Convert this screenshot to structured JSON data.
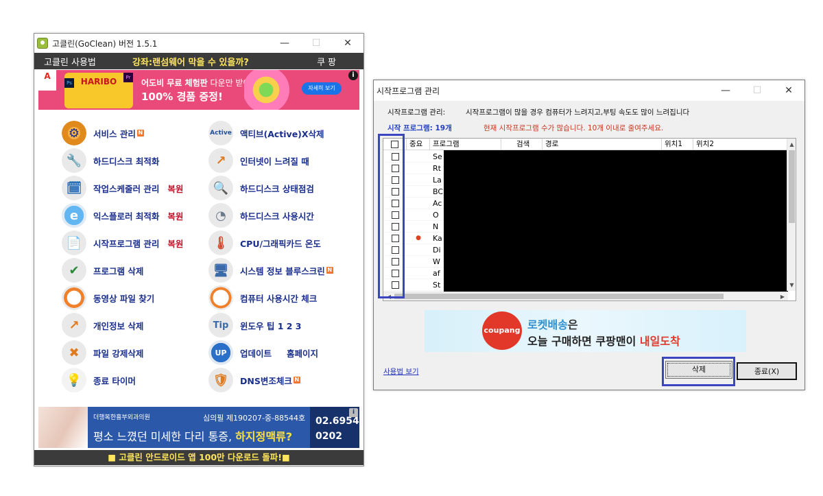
{
  "main_window": {
    "title": "고클린(GoClean) 버전 1.5.1",
    "menu": {
      "left": "고클린 사용법",
      "center": "강좌:랜섬웨어 막을 수 있을까?",
      "right": "쿠팡"
    },
    "top_ad": {
      "adobe_logo": "A",
      "candy_label": "HARIBO",
      "line1_bold": "어도비 무료 체험판",
      "line1_rest": " 다운만 받아도",
      "line2": "100% 경품 증정!",
      "button": "자세히 보기",
      "info": "i"
    },
    "left_items": [
      {
        "label": "서비스 관리",
        "badge": "N",
        "restore": "",
        "icon": "gear-icon"
      },
      {
        "label": "하드디스크 최적화",
        "badge": "",
        "restore": "",
        "icon": "wrench-icon"
      },
      {
        "label": "작업스케줄러 관리",
        "badge": "",
        "restore": "복원",
        "icon": "scheduler-icon"
      },
      {
        "label": "익스플로러 최적화",
        "badge": "",
        "restore": "복원",
        "icon": "ie-icon"
      },
      {
        "label": "시작프로그램 관리",
        "badge": "",
        "restore": "복원",
        "icon": "startup-icon"
      },
      {
        "label": "프로그램 삭제",
        "badge": "",
        "restore": "",
        "icon": "uninstall-icon"
      },
      {
        "label": "동영상 파일 찾기",
        "badge": "",
        "restore": "",
        "icon": "video-search-icon"
      },
      {
        "label": "개인정보 삭제",
        "badge": "",
        "restore": "",
        "icon": "privacy-icon"
      },
      {
        "label": "파일 강제삭제",
        "badge": "",
        "restore": "",
        "icon": "force-delete-icon"
      },
      {
        "label": "종료 타이머",
        "badge": "",
        "restore": "",
        "icon": "timer-icon"
      }
    ],
    "right_items": [
      {
        "label": "액티브(Active)X삭제",
        "badge": "",
        "extra": "",
        "icon": "activex-icon"
      },
      {
        "label": "인터넷이 느려질 때",
        "badge": "",
        "extra": "",
        "icon": "internet-icon"
      },
      {
        "label": "하드디스크 상태점검",
        "badge": "",
        "extra": "",
        "icon": "disk-check-icon"
      },
      {
        "label": "하드디스크 사용시간",
        "badge": "",
        "extra": "",
        "icon": "disk-time-icon"
      },
      {
        "label": "CPU/그래픽카드 온도",
        "badge": "",
        "extra": "",
        "icon": "temperature-icon"
      },
      {
        "label": "시스템 정보  블루스크린",
        "badge": "N",
        "extra": "",
        "icon": "system-info-icon"
      },
      {
        "label": "컴퓨터 사용시간 체크",
        "badge": "",
        "extra": "",
        "icon": "clock-icon"
      },
      {
        "label": "윈도우 팁 1   2   3",
        "badge": "",
        "extra": "",
        "icon": "tip-icon"
      },
      {
        "label": "업데이트",
        "badge": "",
        "extra": "홈페이지",
        "icon": "update-icon"
      },
      {
        "label": "DNS변조체크",
        "badge": "N",
        "extra": "",
        "icon": "shield-icon"
      }
    ],
    "bottom_ad": {
      "clinic": "더행복한흉부외과의원",
      "registration": "심의필 제190207-중-88544호",
      "headline_plain": "평소 느꼈던 미세한 다리 통증, ",
      "headline_bold": "하지정맥류?",
      "phone_line1": "02.6954.",
      "phone_line2": "0202",
      "info": "i"
    },
    "footer": "■ 고클린 안드로이드 앱 100만 다운로드 돌파!■"
  },
  "startup_window": {
    "title": "시작프로그램 관리",
    "header_label": "시작프로그램 관리:",
    "header_desc": "시작프로그램이 많을 경우 컴퓨터가 느려지고,부팅 속도도 많이 느려집니다",
    "count_label": "시작 프로그램: 19개",
    "count_warning": "현재 시작프로그램 수가 많습니다. 10개 이내로 줄여주세요.",
    "columns": [
      "",
      "중요",
      "프로그램",
      "검색",
      "경로",
      "위치1",
      "위치2"
    ],
    "rows": [
      {
        "name": "Se",
        "important": ""
      },
      {
        "name": "Rt",
        "important": ""
      },
      {
        "name": "La",
        "important": ""
      },
      {
        "name": "BC",
        "important": ""
      },
      {
        "name": "Ac",
        "important": ""
      },
      {
        "name": "O",
        "important": ""
      },
      {
        "name": "N",
        "important": ""
      },
      {
        "name": "Ka",
        "important": "●"
      },
      {
        "name": "Di",
        "important": ""
      },
      {
        "name": "W",
        "important": ""
      },
      {
        "name": "af",
        "important": ""
      },
      {
        "name": "St",
        "important": ""
      }
    ],
    "coupang": {
      "badge": "coupang",
      "line1": "로켓배송",
      "line1_suffix": "은",
      "line2_plain": "오늘 구매하면 쿠팡맨이 ",
      "line2_highlight": "내일도착"
    },
    "help_link": "사용법 보기",
    "delete_button": "삭제",
    "close_button": "종료(X)"
  }
}
